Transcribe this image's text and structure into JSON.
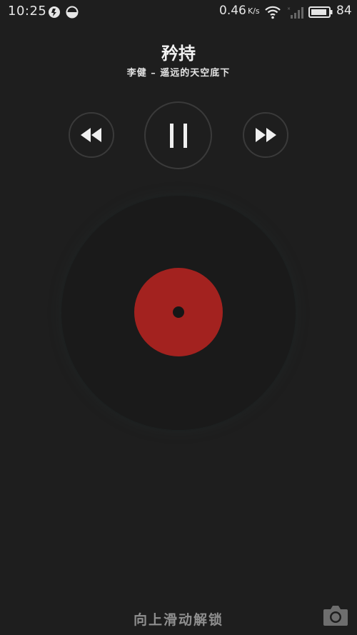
{
  "status_bar": {
    "time": "10:25",
    "network_speed": "0.46",
    "network_unit": "K/s",
    "battery_level": "84",
    "icons": [
      "music-app-icon",
      "half-circle-icon",
      "wifi-icon",
      "signal-icon",
      "battery-icon"
    ]
  },
  "player": {
    "song_title": "矜持",
    "song_subtitle": "李健 – 遥远的天空底下",
    "controls": [
      "rewind-icon",
      "pause-icon",
      "fast-forward-icon"
    ],
    "is_playing": true
  },
  "lockscreen": {
    "unlock_hint": "向上滑动解锁",
    "camera_icon": "camera-icon"
  },
  "colors": {
    "background": "#1e1e1e",
    "disc": "#1a1a1a",
    "disc_label": "#a3221f",
    "control_ring": "#3a3a3a",
    "hint_text": "#8f8f8f"
  }
}
